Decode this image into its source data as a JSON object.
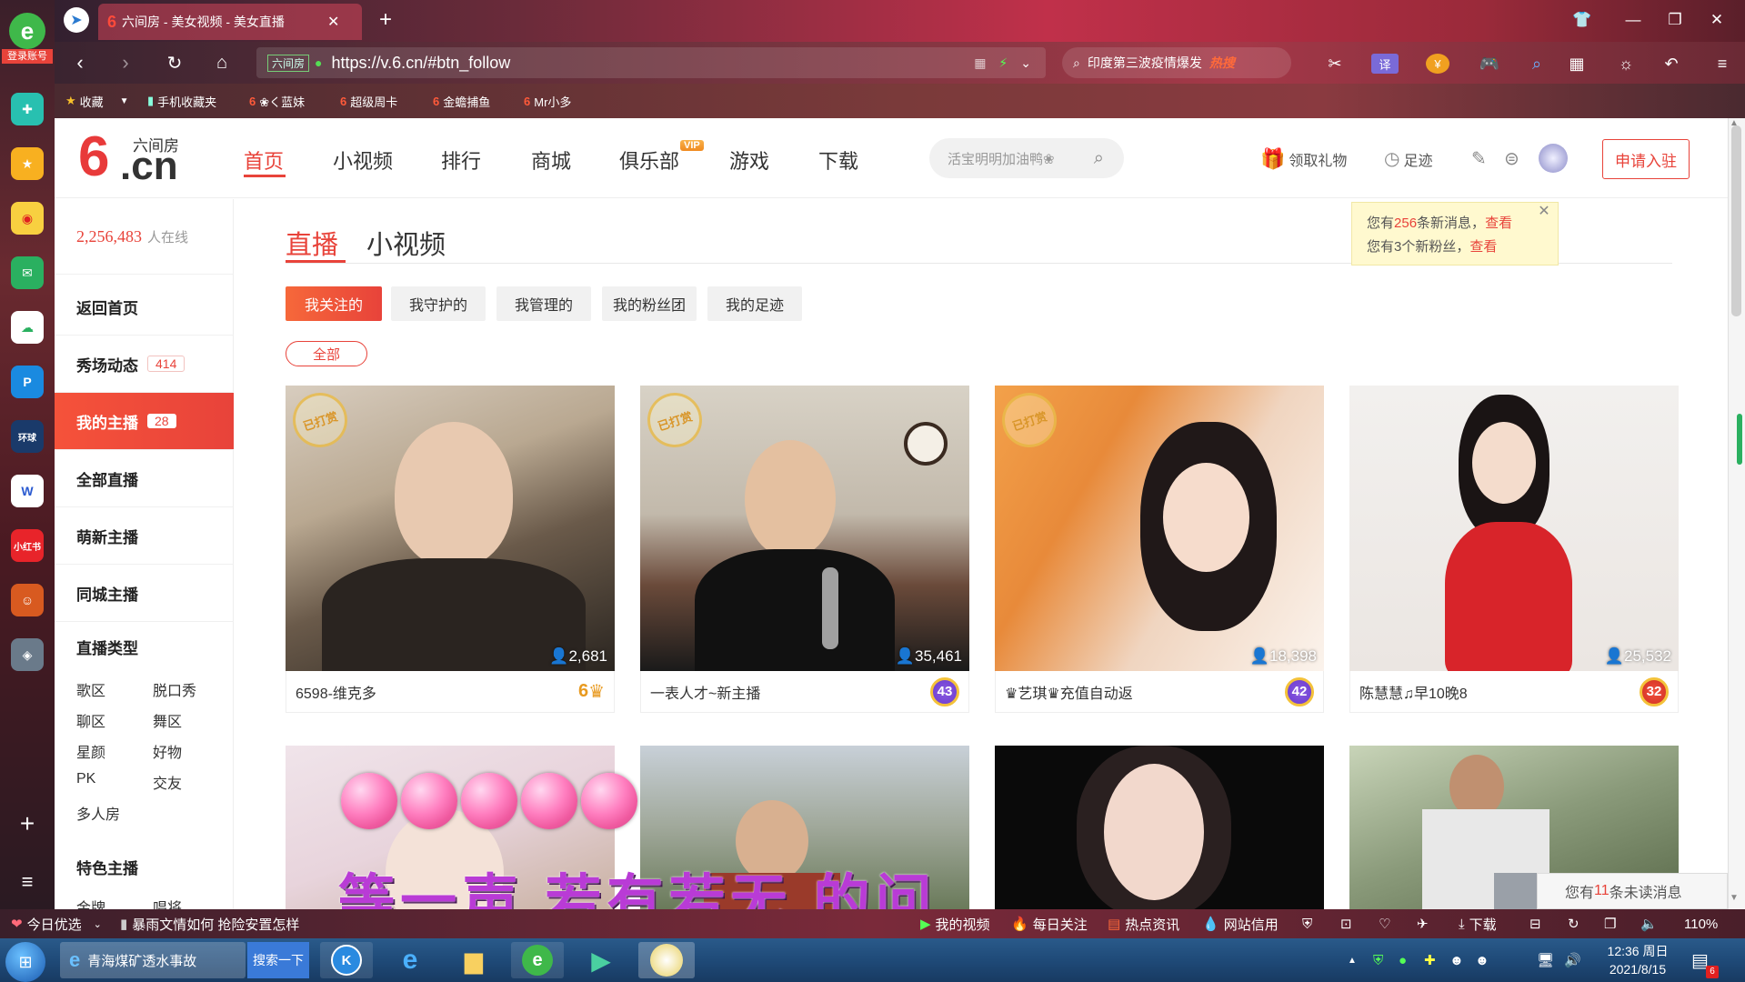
{
  "browser": {
    "tab_title": "六间房 - 美女视频 - 美女直播",
    "url": "https://v.6.cn/#btn_follow",
    "url_tag": "六间房",
    "search_hot": "印度第三波疫情爆发",
    "search_hot_tag": "热搜",
    "login_label": "登录账号",
    "favorites": [
      "收藏",
      "手机收藏夹",
      "❀く蓝妹",
      "超级周卡",
      "金蟾捕鱼",
      "Mr小多"
    ]
  },
  "site": {
    "logo_text": "6.cn",
    "logo_sub": "六间房",
    "nav": [
      "首页",
      "小视频",
      "排行",
      "商城",
      "俱乐部",
      "游戏",
      "下载"
    ],
    "vip_badge": "VIP",
    "search_placeholder": "活宝明明加油鸭❀",
    "gift_label": "领取礼物",
    "history_label": "足迹",
    "join_label": "申请入驻"
  },
  "sidebar": {
    "online_count": "2,256,483",
    "online_suffix": "人在线",
    "items": [
      {
        "label": "返回首页"
      },
      {
        "label": "秀场动态",
        "badge": "414"
      },
      {
        "label": "我的主播",
        "badge": "28"
      },
      {
        "label": "全部直播"
      },
      {
        "label": "萌新主播"
      },
      {
        "label": "同城主播"
      }
    ],
    "types_title": "直播类型",
    "types": [
      "歌区",
      "脱口秀",
      "聊区",
      "舞区",
      "星颜",
      "好物",
      "PK",
      "交友",
      "多人房"
    ],
    "special_title": "特色主播",
    "special_partial": [
      "金牌",
      "唱将"
    ]
  },
  "main": {
    "tabs": [
      "直播",
      "小视频"
    ],
    "filters": [
      "我关注的",
      "我守护的",
      "我管理的",
      "我的粉丝团",
      "我的足迹"
    ],
    "sub_filter": "全部",
    "tip_badge": "已打赏",
    "cards": [
      {
        "name": "6598-维克多",
        "viewers": "2,681",
        "level": "6",
        "tipped": true
      },
      {
        "name": "一表人才~新主播",
        "viewers": "35,461",
        "level": "43",
        "tipped": true
      },
      {
        "name": "♛艺琪♛充值自动返",
        "viewers": "18,398",
        "level": "42",
        "tipped": true
      },
      {
        "name": "陈慧慧♫早10晚8",
        "viewers": "25,532",
        "level": "32",
        "tipped": false
      }
    ]
  },
  "notice": {
    "line1_prefix": "您有",
    "line1_count": "256",
    "line1_suffix": "条新消息，",
    "line1_link": "查看",
    "line2_prefix": "您有3个新粉丝，",
    "line2_link": "查看"
  },
  "overlay": {
    "lyric": "等一声  若有若无  的问"
  },
  "unread": {
    "prefix": "您有",
    "count": "11",
    "suffix": "条未读消息"
  },
  "statusbar": {
    "today": "今日优选",
    "news": "暴雨文情如何 抢险安置怎样",
    "items": [
      "我的视频",
      "每日关注",
      "热点资讯",
      "网站信用"
    ],
    "download": "下载",
    "zoom": "110%"
  },
  "taskbar": {
    "ie_title": "青海煤矿透水事故",
    "search_btn": "搜索一下",
    "time": "12:36 周日",
    "date": "2021/8/15"
  }
}
